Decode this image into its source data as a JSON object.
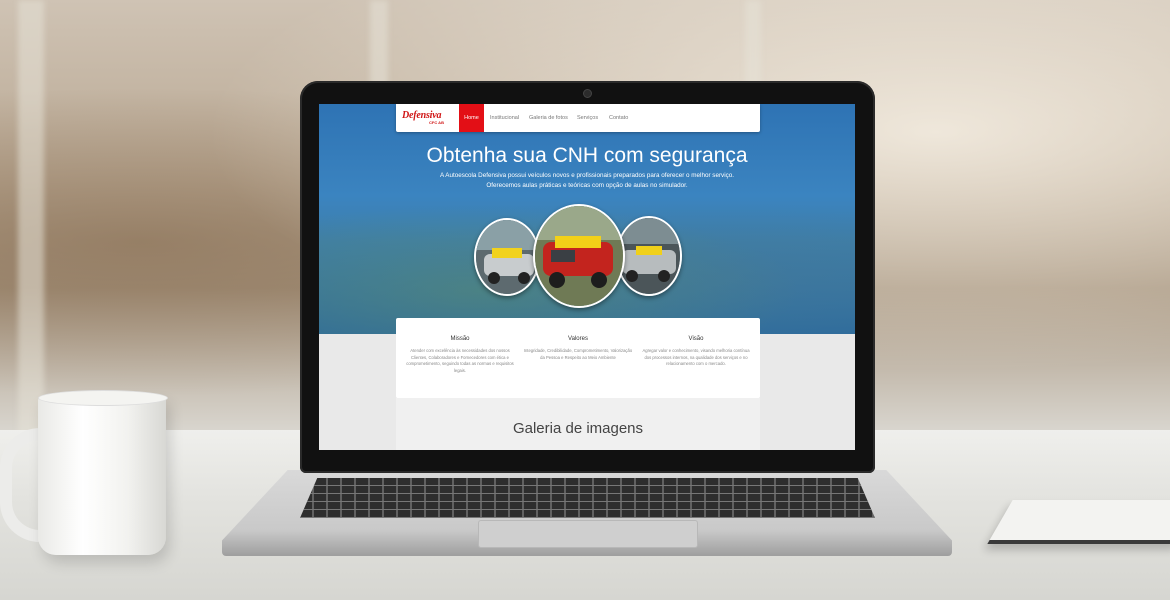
{
  "site": {
    "logo": "Defensiva",
    "logo_sub": "CFC AB",
    "accent_color": "#e30f16",
    "nav": [
      "Home",
      "Institucional",
      "Galeria de fotos",
      "Serviços",
      "Contato"
    ],
    "hero": {
      "title": "Obtenha sua CNH com segurança",
      "line1": "A Autoescola Defensiva possui veículos novos e profissionais preparados para oferecer o melhor serviço.",
      "line2": "Oferecemos aulas práticas e teóricas com opção de aulas no simulador.",
      "photos": [
        "car-photo",
        "car-photo",
        "car-photo"
      ]
    },
    "columns": [
      {
        "title": "Missão",
        "text": "Atender com excelência às necessidades dos nossos Clientes, Colaboradores e Fornecedores com ética e comprometimento, seguindo todas as normas e requisitos legais."
      },
      {
        "title": "Valores",
        "text": "Integridade, Credibilidade, Comprometimento, Valorização da Pessoa e Respeito ao Meio Ambiente"
      },
      {
        "title": "Visão",
        "text": "Agregar valor e conhecimento, visando melhoria contínua dos processos internos, na qualidade dos serviços e no relacionamento com o mercado."
      }
    ],
    "gallery_title": "Galeria de imagens"
  }
}
